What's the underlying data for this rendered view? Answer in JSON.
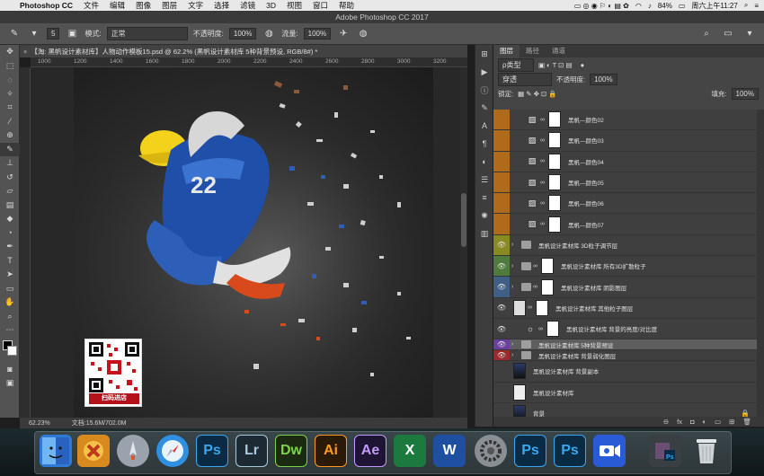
{
  "menubar": {
    "app": "Photoshop CC",
    "items": [
      "文件",
      "编辑",
      "图像",
      "图层",
      "文字",
      "选择",
      "滤镜",
      "3D",
      "视图",
      "窗口",
      "帮助"
    ],
    "battery": "84%",
    "clock": "周六上午11:27"
  },
  "window": {
    "title": "Adobe Photoshop CC 2017"
  },
  "options": {
    "mode_label": "模式:",
    "mode_value": "正常",
    "opacity_label": "不透明度:",
    "opacity_value": "100%",
    "flow_label": "流量:",
    "flow_value": "100%",
    "brush_size": "5"
  },
  "document": {
    "tab": "【淘: 黑帆设计素材库】人物动作模板15.psd @ 62.2% (黑帆设计素材库     5种背景预设, RGB/8#) *",
    "ruler_ticks": [
      "1000",
      "1200",
      "1400",
      "1600",
      "1800",
      "2000",
      "2200",
      "2400",
      "2600",
      "2800",
      "3000",
      "3200"
    ],
    "zoom": "62.23%",
    "doc_size": "文档:15.6M/702.0M",
    "qr_label": "扫码进店"
  },
  "layers_panel": {
    "tabs": [
      "图层",
      "路径",
      "通道"
    ],
    "filter_label": "ρ类型",
    "blend_mode": "穿透",
    "opacity_label": "不透明度:",
    "opacity_value": "100%",
    "lock_label": "锁定:",
    "fill_label": "填充:",
    "fill_value": "100%",
    "layers": [
      {
        "name": "黑帆—颜色02",
        "type": "adj-mask",
        "color": "#b06a1c"
      },
      {
        "name": "黑帆—颜色03",
        "type": "adj-mask",
        "color": "#b06a1c"
      },
      {
        "name": "黑帆—颜色04",
        "type": "adj-mask",
        "color": "#b06a1c"
      },
      {
        "name": "黑帆—颜色05",
        "type": "adj-mask",
        "color": "#b06a1c"
      },
      {
        "name": "黑帆—颜色06",
        "type": "adj-mask",
        "color": "#b06a1c"
      },
      {
        "name": "黑帆—颜色07",
        "type": "adj-mask",
        "color": "#b06a1c"
      },
      {
        "name": "黑帆设计素材库     3D粒子调节层",
        "type": "folder",
        "color": "#8a8a22",
        "eye": true
      },
      {
        "name": "黑帆设计素材库     所有3D扩散粒子",
        "type": "folder-mask",
        "color": "#4f7b3c",
        "eye": true
      },
      {
        "name": "黑帆设计素材库     阴影图层",
        "type": "folder-mask",
        "color": "#3f5f86",
        "eye": true
      },
      {
        "name": "黑帆设计素材库     其他粒子图层",
        "type": "layer-mask",
        "color": "",
        "eye": true
      },
      {
        "name": "黑帆设计素材库     背景的亮度/对比度",
        "type": "adj-mask",
        "color": "",
        "eye": true
      },
      {
        "name": "黑帆设计素材库     5种背景预设",
        "type": "folder",
        "color": "#6a3fa0",
        "eye": true,
        "selected": true
      },
      {
        "name": "黑帆设计素材库     背景弱化图层",
        "type": "folder",
        "color": "#9b2a2a",
        "eye": true
      },
      {
        "name": "黑帆设计素材库     背景副本",
        "type": "layer",
        "color": ""
      },
      {
        "name": "黑帆设计素材库",
        "type": "layer",
        "color": ""
      },
      {
        "name": "背景",
        "type": "layer",
        "color": ""
      }
    ],
    "footer": [
      "⊖",
      "fx",
      "◘",
      "◐",
      "▭",
      "⊞",
      "🗑"
    ]
  },
  "dock": {
    "items": [
      {
        "label": "",
        "color": "#2f7ad6",
        "name": "finder"
      },
      {
        "label": "",
        "color": "#d98a1f",
        "name": "xmind"
      },
      {
        "label": "",
        "color": "#9aa3ad",
        "name": "launchpad"
      },
      {
        "label": "",
        "color": "#2f8fe0",
        "name": "safari"
      },
      {
        "label": "Ps",
        "color": "#0b2a43",
        "text": "#39a8f0",
        "name": "photoshop"
      },
      {
        "label": "Lr",
        "color": "#1d2a33",
        "text": "#a9cbe0",
        "name": "lightroom"
      },
      {
        "label": "Dw",
        "color": "#1b2a10",
        "text": "#7dd44a",
        "name": "dreamweaver"
      },
      {
        "label": "Ai",
        "color": "#2b1a08",
        "text": "#ff9a1f",
        "name": "illustrator"
      },
      {
        "label": "Ae",
        "color": "#1e1433",
        "text": "#c39aff",
        "name": "aftereffects"
      },
      {
        "label": "X",
        "color": "#1d7a3e",
        "text": "#ffffff",
        "name": "excel"
      },
      {
        "label": "W",
        "color": "#1f4fa0",
        "text": "#ffffff",
        "name": "word"
      },
      {
        "label": "",
        "color": "#8a8f96",
        "name": "system-preferences"
      },
      {
        "label": "Ps",
        "color": "#0b2a43",
        "text": "#39a8f0",
        "name": "photoshop-2"
      },
      {
        "label": "Ps",
        "color": "#0b2a43",
        "text": "#39a8f0",
        "name": "photoshop-3"
      },
      {
        "label": "",
        "color": "#2a5bd6",
        "name": "screen-recorder"
      },
      {
        "label": "",
        "color": "#3a3f44",
        "name": "photoshop-document"
      },
      {
        "label": "",
        "color": "#cfd3d6",
        "name": "trash"
      }
    ]
  }
}
